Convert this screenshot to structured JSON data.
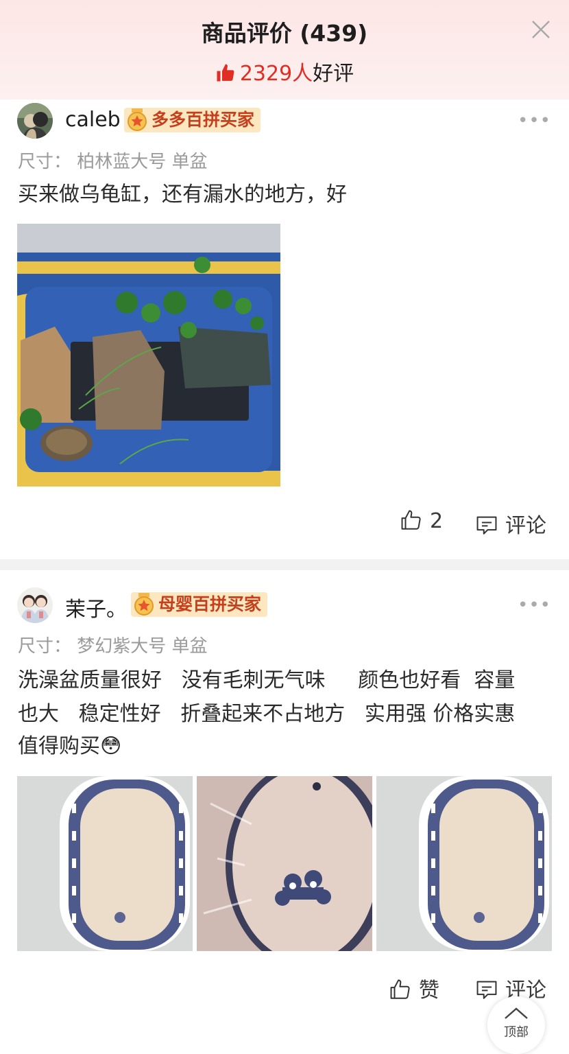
{
  "header": {
    "title": "商品评价 (439)",
    "good_count": "2329人",
    "good_label": "好评"
  },
  "reviews": [
    {
      "user": "caleb",
      "badge": "多多百拼买家",
      "spec": "尺寸：  柏林蓝大号 单盆",
      "text": [
        "买来做乌龟缸，还有漏水的地方，好"
      ],
      "like_label": "2",
      "comment_label": "评论"
    },
    {
      "user": "茉子。",
      "badge": "母婴百拼买家",
      "spec": "尺寸：  梦幻紫大号 单盆",
      "text": [
        "洗澡盆质量很好   没有毛刺无气味     颜色也好看  容量",
        "也大   稳定性好   折叠起来不占地方   实用强 价格实惠",
        "值得购买"
      ],
      "emoji": "😳",
      "like_label": "赞",
      "comment_label": "评论"
    }
  ],
  "back_to_top": "顶部",
  "colors": {
    "accent_red": "#e02e24",
    "badge_bg": "#fde7c0",
    "badge_text": "#c4401d",
    "header_bg": "#fde6e6"
  }
}
